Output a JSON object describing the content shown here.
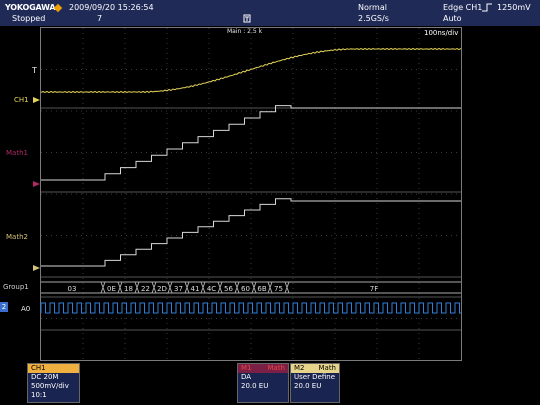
{
  "header": {
    "brand": "YOKOGAWA",
    "timestamp": "2009/09/20 15:26:54",
    "state": "Stopped",
    "count": "7",
    "acq_mode": "Normal",
    "sample_rate": "2.5GS/s",
    "trigger": "Edge CH1",
    "trigger_level": "1250mV",
    "trigger_mode": "Auto"
  },
  "screen": {
    "main_label": "Main : 2.5 k",
    "time_div": "100ns/div",
    "trigger_marker": "T"
  },
  "channels": {
    "ch1": "CH1",
    "math1": "Math1",
    "math2": "Math2",
    "group1": "Group1",
    "a0": "A0",
    "a0_badge": "2"
  },
  "group1_values": [
    "03",
    "0E",
    "18",
    "22",
    "2D",
    "37",
    "41",
    "4C",
    "56",
    "60",
    "6B",
    "75",
    "7F"
  ],
  "panels": {
    "ch1": {
      "title": "CH1",
      "lines": [
        "DC 20M",
        "500mV/div",
        "10:1"
      ]
    },
    "m1": {
      "title": "M1",
      "lines": [
        "DA",
        "20.0 EU"
      ],
      "title2": "Math"
    },
    "m2": {
      "title": "M2",
      "lines": [
        "User Define",
        "20.0 EU"
      ],
      "title2": "Math"
    }
  },
  "colors": {
    "ch1": "#e6d45a",
    "math1": "#b02a63",
    "math2": "#d4c47a",
    "logic": "#2f7fd8",
    "header_bg": "#1f2a57",
    "accent": "#f0a000"
  }
}
